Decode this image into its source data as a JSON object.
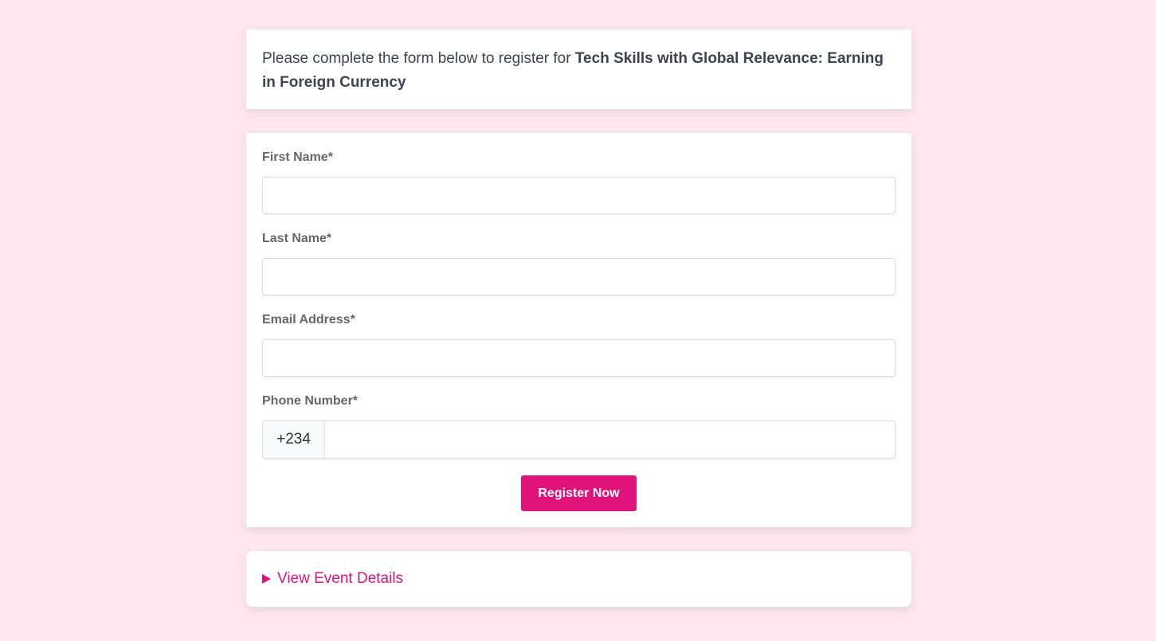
{
  "intro": {
    "prefix": "Please complete the form below to register for ",
    "event_title": "Tech Skills with Global Relevance: Earning in Foreign Currency"
  },
  "form": {
    "first_name_label": "First Name*",
    "first_name_value": "",
    "last_name_label": "Last Name*",
    "last_name_value": "",
    "email_label": "Email Address*",
    "email_value": "",
    "phone_label": "Phone Number*",
    "phone_prefix": "+234",
    "phone_value": "",
    "submit_label": "Register Now"
  },
  "details": {
    "toggle_label": "View Event Details"
  },
  "colors": {
    "background": "#fde6ee",
    "accent": "#e0137a",
    "label": "#676767",
    "text": "#3d4451"
  },
  "icons": {
    "details_toggle": "triangle-right-icon"
  }
}
